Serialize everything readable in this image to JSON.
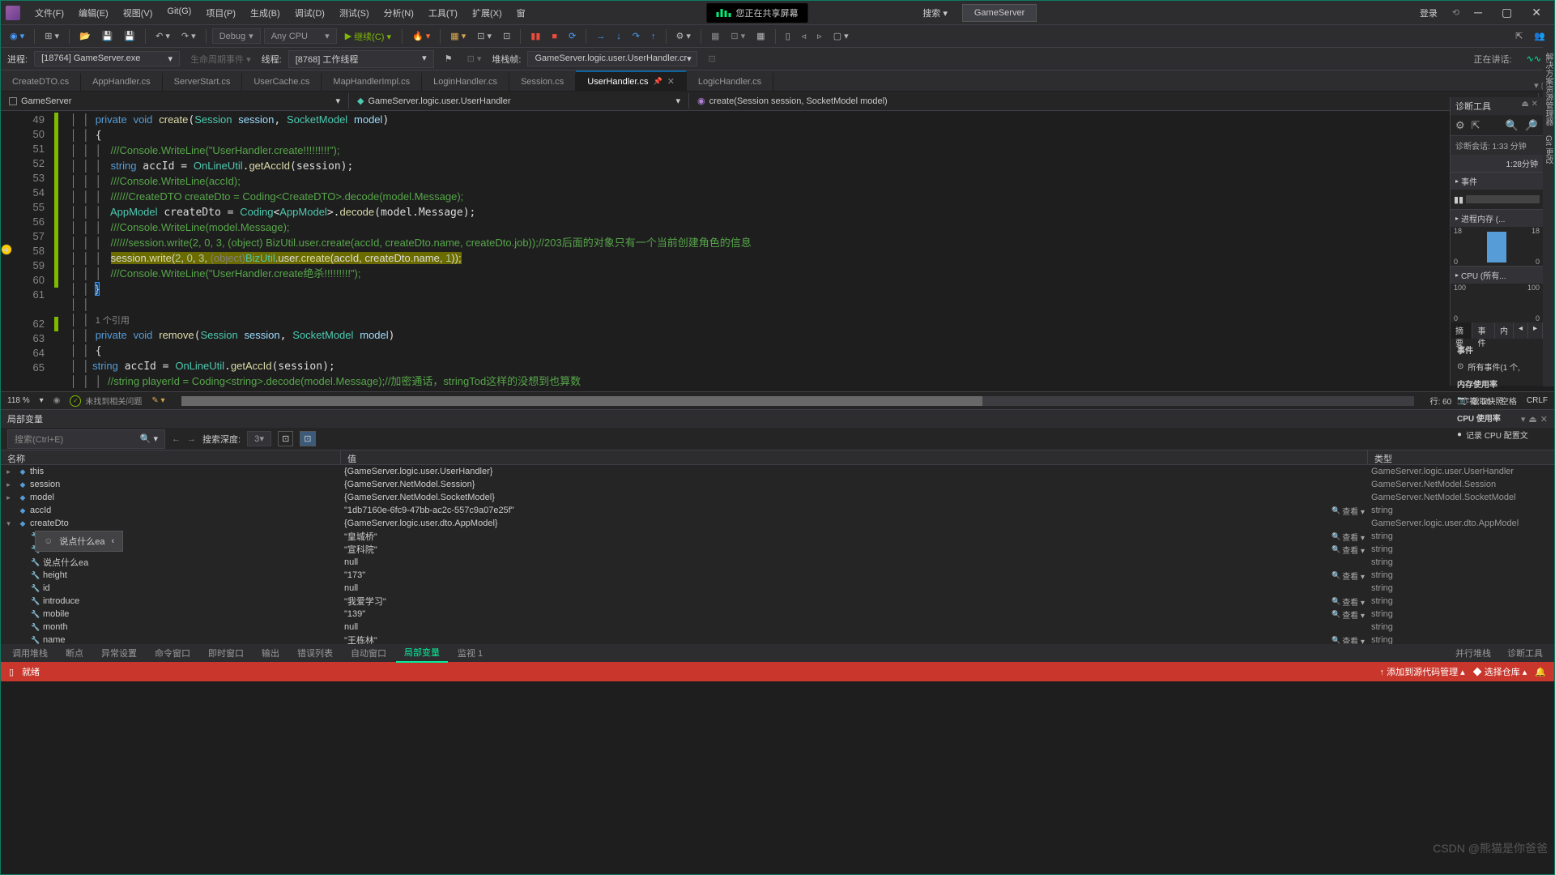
{
  "menu": {
    "file": "文件(F)",
    "edit": "编辑(E)",
    "view": "视图(V)",
    "git": "Git(G)",
    "project": "项目(P)",
    "build": "生成(B)",
    "debug": "调试(D)",
    "test": "测试(S)",
    "analyze": "分析(N)",
    "tools": "工具(T)",
    "ext": "扩展(X)",
    "win": "窗"
  },
  "share": "您正在共享屏幕",
  "search": "搜索 ▾",
  "gameserver": "GameServer",
  "login": "登录",
  "toolbar": {
    "debug": "Debug",
    "anycpu": "Any CPU",
    "continue": "继续(C) ▾"
  },
  "debugbar": {
    "proc_lbl": "进程:",
    "proc": "[18764] GameServer.exe",
    "lifecycle": "生命周期事件 ▾",
    "thread_lbl": "线程:",
    "thread": "[8768] 工作线程",
    "stack_lbl": "堆栈帧:",
    "stack": "GameServer.logic.user.UserHandler.cr",
    "talking": "正在讲话:"
  },
  "tabs": [
    "CreateDTO.cs",
    "AppHandler.cs",
    "ServerStart.cs",
    "UserCache.cs",
    "MapHandlerImpl.cs",
    "LoginHandler.cs",
    "Session.cs",
    "UserHandler.cs",
    "LogicHandler.cs"
  ],
  "nav": {
    "s1": "GameServer",
    "s2": "GameServer.logic.user.UserHandler",
    "s3": "create(Session session, SocketModel model)"
  },
  "lines": [
    "49",
    "50",
    "51",
    "52",
    "53",
    "54",
    "55",
    "56",
    "57",
    "58",
    "59",
    "60",
    "61",
    "",
    "62",
    "63",
    "64",
    "65"
  ],
  "strip": {
    "zoom": "118 %",
    "ok": "未找到相关问题",
    "ln": "行: 60",
    "ch": "字符: 10",
    "spaces": "空格",
    "crlf": "CRLF"
  },
  "diag": {
    "tool": "诊断工具",
    "session": "诊断会话: 1:33 分钟",
    "t2": "1:28分钟",
    "events": "事件",
    "pause": "▮▮",
    "mem": "进程内存 (...",
    "ml": "18",
    "mr": "18",
    "mz": "0",
    "cpu": "CPU (所有...",
    "cl": "100",
    "cr": "100",
    "cz": "0",
    "tabs": [
      "摘要",
      "事件",
      "内"
    ],
    "sec_events": "事件",
    "all_events": "所有事件(1 个,",
    "sec_mem": "内存使用率",
    "snapshot": "截取快照",
    "sec_cpu": "CPU 使用率",
    "record": "记录 CPU 配置文"
  },
  "side": [
    "解决方案资源管理器",
    "Git 更改"
  ],
  "locals": {
    "title": "局部变量",
    "search_ph": "搜索(Ctrl+E)",
    "depth_lbl": "搜索深度:",
    "depth": "3",
    "c1": "名称",
    "c2": "值",
    "c3": "类型",
    "view": "查看"
  },
  "vars": [
    {
      "i": 0,
      "n": "this",
      "v": "{GameServer.logic.user.UserHandler}",
      "t": "GameServer.logic.user.UserHandler",
      "e": "▸",
      "ic": "obj"
    },
    {
      "i": 0,
      "n": "session",
      "v": "{GameServer.NetModel.Session}",
      "t": "GameServer.NetModel.Session",
      "e": "▸",
      "ic": "obj"
    },
    {
      "i": 0,
      "n": "model",
      "v": "{GameServer.NetModel.SocketModel}",
      "t": "GameServer.NetModel.SocketModel",
      "e": "▸",
      "ic": "obj"
    },
    {
      "i": 0,
      "n": "accId",
      "v": "\"1db7160e-6fc9-47bb-ac2c-557c9a07e25f\"",
      "t": "string",
      "e": "",
      "ic": "obj",
      "q": 1
    },
    {
      "i": 0,
      "n": "createDto",
      "v": "{GameServer.logic.user.dto.AppModel}",
      "t": "GameServer.logic.user.dto.AppModel",
      "e": "▾",
      "ic": "obj"
    },
    {
      "i": 1,
      "n": "address",
      "v": "\"皇城桥\"",
      "t": "string",
      "e": "",
      "ic": "prop",
      "q": 1
    },
    {
      "i": 1,
      "n": "business",
      "v": "\"宣科院\"",
      "t": "string",
      "e": "",
      "ic": "prop",
      "q": 1
    },
    {
      "i": 1,
      "n": "说点什么ea",
      "v": "null",
      "t": "string",
      "e": "",
      "ic": "prop"
    },
    {
      "i": 1,
      "n": "height",
      "v": "\"173\"",
      "t": "string",
      "e": "",
      "ic": "prop",
      "q": 1
    },
    {
      "i": 1,
      "n": "id",
      "v": "null",
      "t": "string",
      "e": "",
      "ic": "prop"
    },
    {
      "i": 1,
      "n": "introduce",
      "v": "\"我爱学习\"",
      "t": "string",
      "e": "",
      "ic": "prop",
      "q": 1
    },
    {
      "i": 1,
      "n": "mobile",
      "v": "\"139\"",
      "t": "string",
      "e": "",
      "ic": "prop",
      "q": 1
    },
    {
      "i": 1,
      "n": "month",
      "v": "null",
      "t": "string",
      "e": "",
      "ic": "prop"
    },
    {
      "i": 1,
      "n": "name",
      "v": "\"王栋林\"",
      "t": "string",
      "e": "",
      "ic": "prop",
      "q": 1
    }
  ],
  "btabs": [
    "调用堆栈",
    "断点",
    "异常设置",
    "命令窗口",
    "即时窗口",
    "输出",
    "错误列表",
    "自动窗口",
    "局部变量",
    "监视 1"
  ],
  "btabs_r": [
    "并行堆栈",
    "诊断工具"
  ],
  "status": {
    "ready": "就绪",
    "scm": "↑ 添加到源代码管理 ▴",
    "repo": "◆ 选择仓库 ▴"
  },
  "hint": "说点什么ea",
  "watermark": "CSDN @熊猫是你爸爸"
}
